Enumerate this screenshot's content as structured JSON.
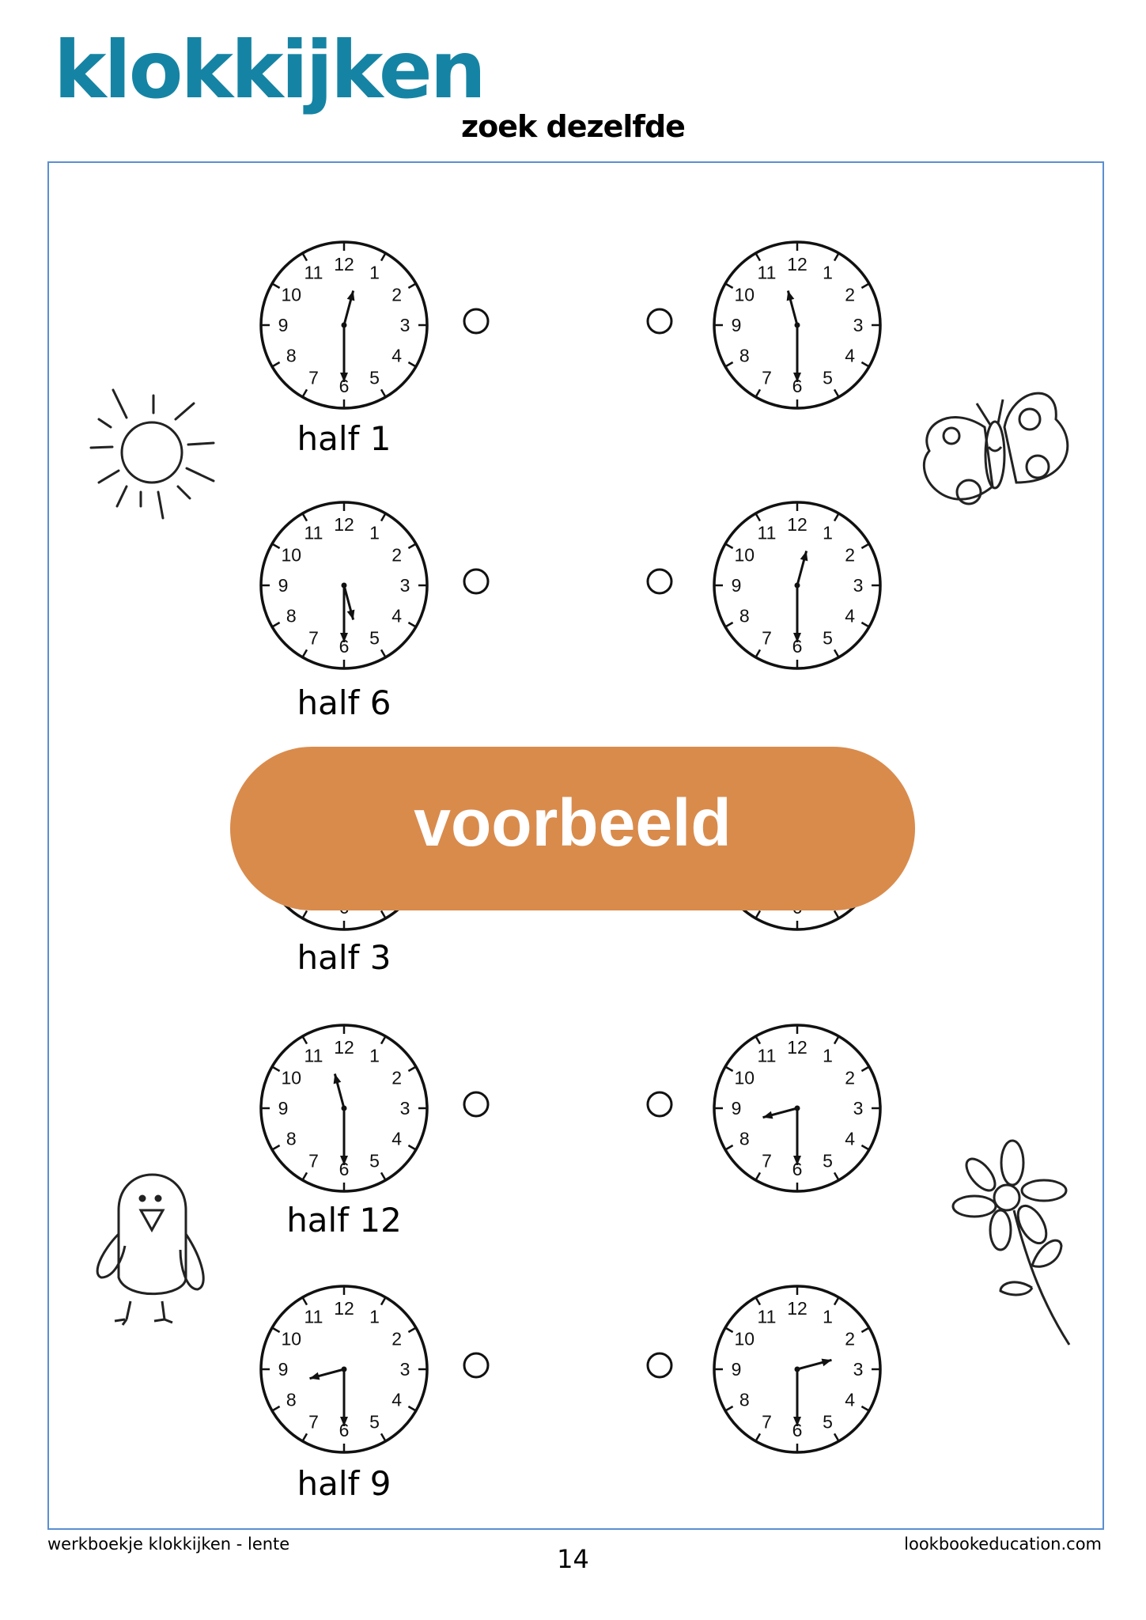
{
  "header": {
    "title": "klokkijken",
    "subtitle": "zoek dezelfde"
  },
  "colors": {
    "title": "#1584a4",
    "frame": "#5b8fd0",
    "banner": "#d98b4c"
  },
  "clock_numerals": [
    "12",
    "1",
    "2",
    "3",
    "4",
    "5",
    "6",
    "7",
    "8",
    "9",
    "10",
    "11"
  ],
  "rows": [
    {
      "label": "half 1",
      "left": {
        "hour": 12,
        "minute": 30
      },
      "right": {
        "hour": 11,
        "minute": 30
      }
    },
    {
      "label": "half 6",
      "left": {
        "hour": 5,
        "minute": 30
      },
      "right": {
        "hour": 12,
        "minute": 30
      }
    },
    {
      "label": "half 3",
      "left": null,
      "right": null
    },
    {
      "label": "half 12",
      "left": {
        "hour": 11,
        "minute": 30
      },
      "right": {
        "hour": 8,
        "minute": 30
      }
    },
    {
      "label": "half 9",
      "left": {
        "hour": 8,
        "minute": 30
      },
      "right": {
        "hour": 2,
        "minute": 30
      }
    }
  ],
  "banner": {
    "text": "voorbeeld"
  },
  "decorations": [
    "sun-icon",
    "butterfly-icon",
    "bird-icon",
    "flower-icon"
  ],
  "footer": {
    "left": "werkboekje klokkijken - lente",
    "page": "14",
    "right": "lookbookeducation.com"
  }
}
